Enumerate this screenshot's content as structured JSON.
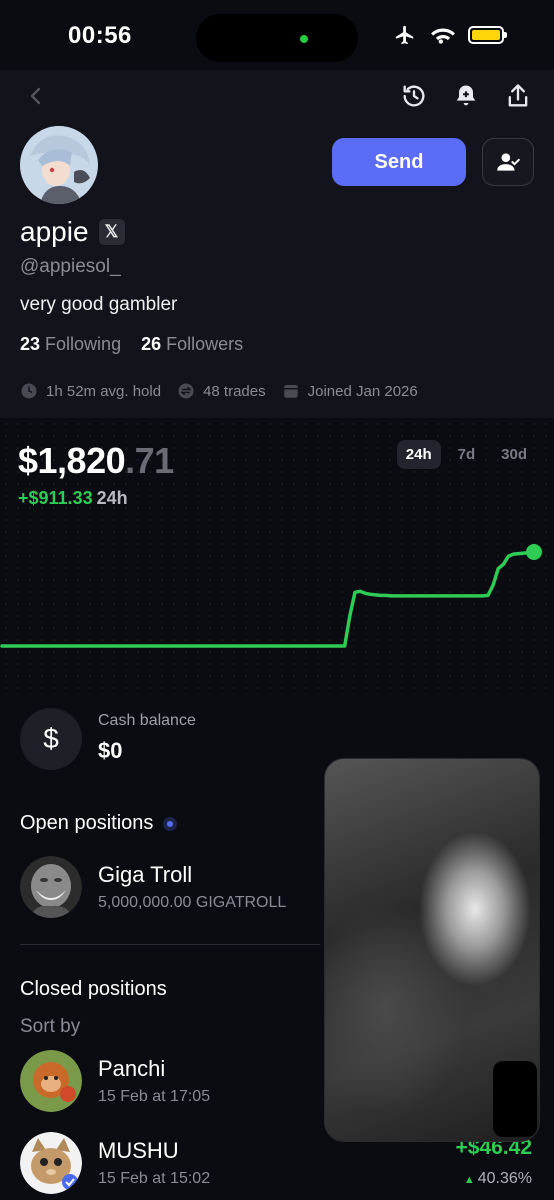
{
  "status_bar": {
    "time": "00:56",
    "icons": [
      "airplane-icon",
      "wifi-icon",
      "battery-icon"
    ],
    "battery_color": "#ffd60a"
  },
  "nav": {
    "icons": [
      "back-icon",
      "history-icon",
      "bell-icon",
      "share-icon"
    ]
  },
  "profile": {
    "name": "appie",
    "x_badge": "𝕏",
    "handle": "@appiesol_",
    "bio": "very good gambler",
    "following_count": "23",
    "following_label": "Following",
    "followers_count": "26",
    "followers_label": "Followers",
    "avg_hold": "1h 52m avg. hold",
    "trades": "48 trades",
    "joined": "Joined Jan 2026",
    "send_label": "Send"
  },
  "portfolio": {
    "balance_main": "$1,820",
    "balance_cents": ".71",
    "change": "+$911.33",
    "change_period": "24h",
    "periods": [
      "24h",
      "7d",
      "30d"
    ],
    "active_period": "24h",
    "line_color": "#2ecc55"
  },
  "chart_data": {
    "type": "line",
    "title": "",
    "xlabel": "",
    "ylabel": "",
    "series": [
      {
        "values": [
          909,
          909,
          909,
          909,
          909,
          909,
          909,
          909,
          909,
          909,
          909,
          909,
          909,
          909,
          909,
          909,
          909,
          909,
          909,
          909,
          909,
          909,
          909,
          909,
          909,
          909,
          909,
          909,
          909,
          909,
          909,
          909,
          909,
          909,
          909,
          909,
          909,
          909,
          909,
          909,
          909,
          909,
          909,
          909,
          909,
          909,
          909,
          909,
          909,
          909,
          909,
          909,
          909,
          909,
          909,
          909,
          909,
          909,
          909,
          909,
          909,
          909,
          909,
          909,
          909,
          909,
          909,
          909,
          1200,
          1430,
          1440,
          1420,
          1410,
          1405,
          1400,
          1400,
          1395,
          1395,
          1395,
          1395,
          1395,
          1395,
          1395,
          1395,
          1395,
          1395,
          1395,
          1395,
          1395,
          1395,
          1395,
          1395,
          1395,
          1395,
          1395,
          1400,
          1500,
          1660,
          1700,
          1780,
          1800,
          1805,
          1810,
          1815,
          1820.71
        ]
      }
    ],
    "grid": true,
    "legend": "none"
  },
  "cash": {
    "label": "Cash balance",
    "value": "$0",
    "icon": "$"
  },
  "open_positions": {
    "title": "Open positions",
    "items": [
      {
        "name": "Giga Troll",
        "sub": "5,000,000.00 GIGATROLL"
      }
    ]
  },
  "closed_positions": {
    "title": "Closed positions",
    "sort_label": "Sort by",
    "items": [
      {
        "name": "Panchi",
        "sub": "15 Feb at 17:05"
      },
      {
        "name": "MUSHU",
        "sub": "15 Feb at 15:02",
        "pnl": "+$46.42",
        "pct": "40.36%"
      }
    ]
  }
}
